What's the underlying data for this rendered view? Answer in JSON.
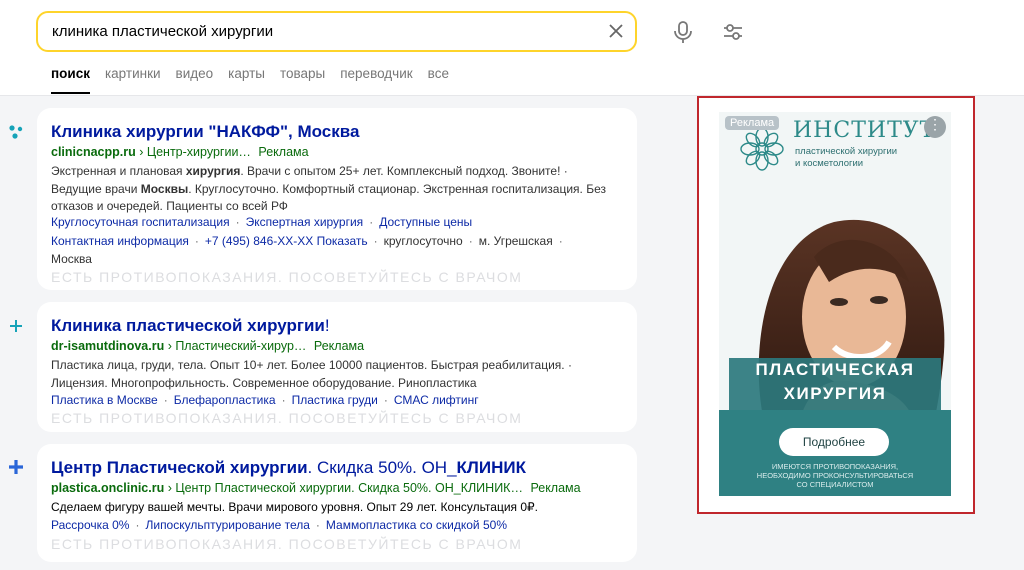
{
  "search": {
    "query": "клиника пластической хирургии"
  },
  "tabs": [
    "поиск",
    "картинки",
    "видео",
    "карты",
    "товары",
    "переводчик",
    "все"
  ],
  "results": [
    {
      "title_bold": "Клиника хирургии ",
      "title_quote": "\"НАКФФ\", Москва",
      "domain": "clinicnacpp.ru",
      "path": " › Центр-хирургии…",
      "badge": "Реклама",
      "snippet_a": "Экстренная и плановая ",
      "snippet_b": "хирургия",
      "snippet_c": ". Врачи с опытом 25+ лет. Комплексный подход. Звоните! · Ведущие врачи ",
      "snippet_d": "Москвы",
      "snippet_e": ". Круглосуточно. Комфортный стационар. Экстренная госпитализация. Без отказов и очередей. Пациенты со всей РФ",
      "sitelinks": [
        "Круглосуточная госпитализация",
        "Экспертная хирургия",
        "Доступные цены"
      ],
      "contact": "Контактная информация",
      "phone": "+7 (495) 846-ХХ-ХХ Показать",
      "hours": "круглосуточно",
      "metro": "м. Угрешская",
      "city": "Москва",
      "warning": "ЕСТЬ ПРОТИВОПОКАЗАНИЯ. ПОСОВЕТУЙТЕСЬ С ВРАЧОМ"
    },
    {
      "title_bold": "Клиника пластической хирургии",
      "title_tail": "!",
      "domain": "dr-isamutdinova.ru",
      "path": " › Пластический-хирур…",
      "badge": "Реклама",
      "snippet": "Пластика лица, груди, тела. Опыт 10+ лет. Более 10000 пациентов. Быстрая реабилитация. · Лицензия. Многопрофильность. Современное оборудование. Ринопластика",
      "sitelinks": [
        "Пластика в Москве",
        "Блефаропластика",
        "Пластика груди",
        "СМАС лифтинг"
      ],
      "warning": "ЕСТЬ ПРОТИВОПОКАЗАНИЯ. ПОСОВЕТУЙТЕСЬ С ВРАЧОМ"
    },
    {
      "title_bold": "Центр Пластической хирургии",
      "title_plain": ". Скидка 50%. ОН_",
      "title_bold2": "КЛИНИК",
      "domain": "plastica.onclinic.ru",
      "path": " › Центр Пластической хирургии. Скидка 50%. ОН_КЛИНИК…",
      "badge": "Реклама",
      "snippet": "Сделаем фигуру вашей мечты. Врачи мирового уровня. Опыт 29 лет. Консультация 0₽.",
      "sitelinks": [
        "Рассрочка 0%",
        "Липоскульптурирование тела",
        "Маммопластика со скидкой 50%"
      ],
      "warning": "ЕСТЬ ПРОТИВОПОКАЗАНИЯ. ПОСОВЕТУЙТЕСЬ С ВРАЧОМ"
    }
  ],
  "ad": {
    "label": "Реклама",
    "brand": "ИНСТИТУТ",
    "sub1": "пластической хирургии",
    "sub2": "и косметологии",
    "banner1": "ПЛАСТИЧЕСКАЯ",
    "banner2": "ХИРУРГИЯ",
    "button": "Подробнее",
    "note1": "ИМЕЮТСЯ ПРОТИВОПОКАЗАНИЯ,",
    "note2": "НЕОБХОДИМО ПРОКОНСУЛЬТИРОВАТЬСЯ",
    "note3": "СО СПЕЦИАЛИСТОМ"
  },
  "colors": {
    "accent": "#fed42b",
    "link": "#001a9e",
    "url": "#0a6b0d",
    "ad_border": "#c0272d",
    "ad_teal": "#2f8183"
  },
  "icons": [
    "close-icon",
    "microphone-icon",
    "filters-icon",
    "cluster-icon",
    "plus-icon",
    "plus-blue-icon",
    "more-icon",
    "flower-logo-icon"
  ]
}
